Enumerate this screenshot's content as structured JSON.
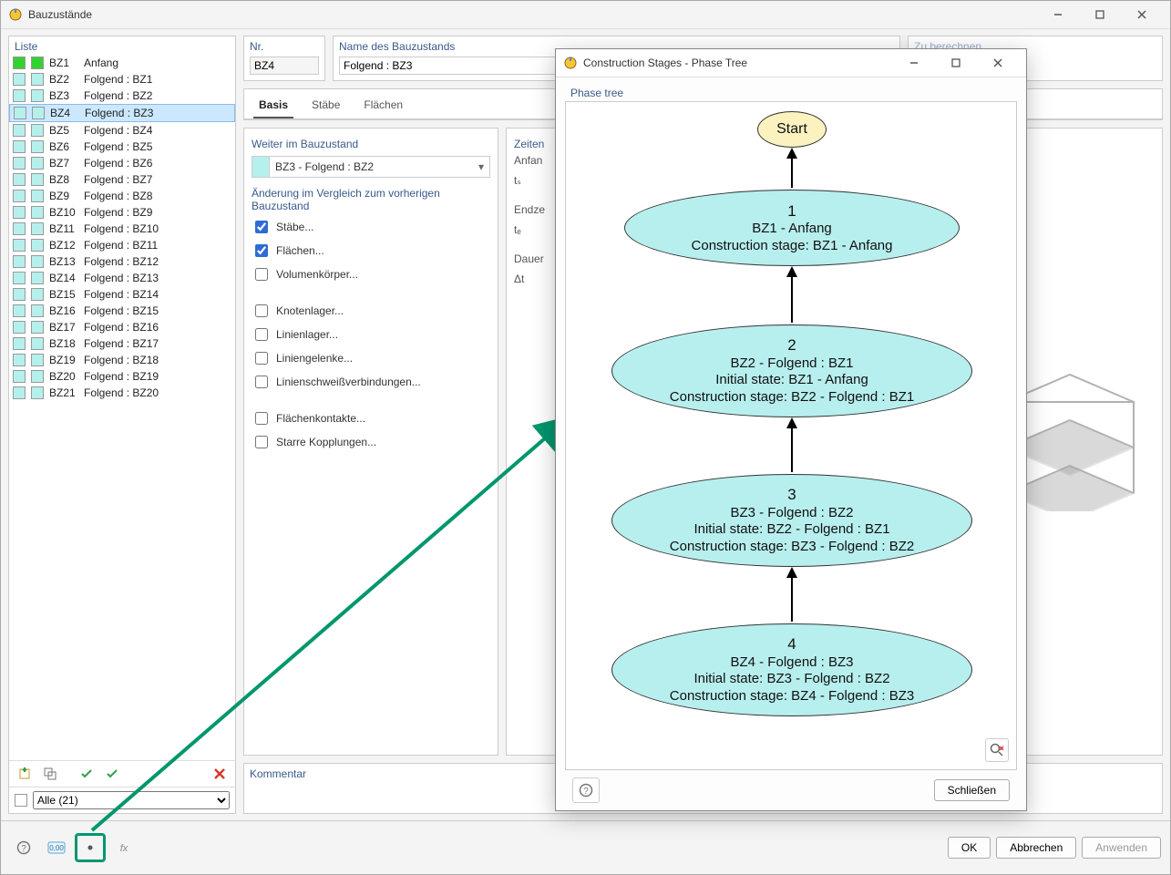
{
  "main_window": {
    "title": "Bauzustände"
  },
  "liste": {
    "title": "Liste",
    "items": [
      {
        "id": "BZ1",
        "label": "Anfang",
        "swatch": "#32d232"
      },
      {
        "id": "BZ2",
        "label": "Folgend : BZ1",
        "swatch": "#b6f0ec"
      },
      {
        "id": "BZ3",
        "label": "Folgend : BZ2",
        "swatch": "#b6f0ec"
      },
      {
        "id": "BZ4",
        "label": "Folgend : BZ3",
        "swatch": "#b6f0ec",
        "selected": true
      },
      {
        "id": "BZ5",
        "label": "Folgend : BZ4",
        "swatch": "#b6f0ec"
      },
      {
        "id": "BZ6",
        "label": "Folgend : BZ5",
        "swatch": "#b6f0ec"
      },
      {
        "id": "BZ7",
        "label": "Folgend : BZ6",
        "swatch": "#b6f0ec"
      },
      {
        "id": "BZ8",
        "label": "Folgend : BZ7",
        "swatch": "#b6f0ec"
      },
      {
        "id": "BZ9",
        "label": "Folgend : BZ8",
        "swatch": "#b6f0ec"
      },
      {
        "id": "BZ10",
        "label": "Folgend : BZ9",
        "swatch": "#b6f0ec"
      },
      {
        "id": "BZ11",
        "label": "Folgend : BZ10",
        "swatch": "#b6f0ec"
      },
      {
        "id": "BZ12",
        "label": "Folgend : BZ11",
        "swatch": "#b6f0ec"
      },
      {
        "id": "BZ13",
        "label": "Folgend : BZ12",
        "swatch": "#b6f0ec"
      },
      {
        "id": "BZ14",
        "label": "Folgend : BZ13",
        "swatch": "#b6f0ec"
      },
      {
        "id": "BZ15",
        "label": "Folgend : BZ14",
        "swatch": "#b6f0ec"
      },
      {
        "id": "BZ16",
        "label": "Folgend : BZ15",
        "swatch": "#b6f0ec"
      },
      {
        "id": "BZ17",
        "label": "Folgend : BZ16",
        "swatch": "#b6f0ec"
      },
      {
        "id": "BZ18",
        "label": "Folgend : BZ17",
        "swatch": "#b6f0ec"
      },
      {
        "id": "BZ19",
        "label": "Folgend : BZ18",
        "swatch": "#b6f0ec"
      },
      {
        "id": "BZ20",
        "label": "Folgend : BZ19",
        "swatch": "#b6f0ec"
      },
      {
        "id": "BZ21",
        "label": "Folgend : BZ20",
        "swatch": "#b6f0ec"
      }
    ],
    "filter_label": "Alle (21)"
  },
  "nr": {
    "title": "Nr.",
    "value": "BZ4"
  },
  "name": {
    "title": "Name des Bauzustands",
    "value": "Folgend : BZ3"
  },
  "berechnen": {
    "title": "Zu berechnen"
  },
  "tabs": {
    "basis": "Basis",
    "staebe": "Stäbe",
    "flaechen": "Flächen"
  },
  "basis": {
    "weiter_title": "Weiter im Bauzustand",
    "weiter_value": "BZ3 - Folgend : BZ2",
    "aenderung_title": "Änderung im Vergleich zum vorherigen Bauzustand",
    "checks": {
      "staebe": "Stäbe...",
      "flaechen": "Flächen...",
      "volumen": "Volumenkörper...",
      "knotenlager": "Knotenlager...",
      "linienlager": "Linienlager...",
      "liniengelenke": "Liniengelenke...",
      "linienschweiss": "Linienschweißverbindungen...",
      "flaechenkontakte": "Flächenkontakte...",
      "starre": "Starre Kopplungen..."
    }
  },
  "zeiten": {
    "title": "Zeiten",
    "anfang": "Anfan",
    "ts": "tₛ",
    "endz": "Endze",
    "te": "tₑ",
    "dauer": "Dauer",
    "dt": "Δt"
  },
  "kommentar": {
    "title": "Kommentar"
  },
  "footer": {
    "ok": "OK",
    "abbrechen": "Abbrechen",
    "anwenden": "Anwenden"
  },
  "dialog": {
    "title": "Construction Stages - Phase Tree",
    "section": "Phase tree",
    "close_btn": "Schließen",
    "start": "Start",
    "nodes": [
      {
        "num": "1",
        "line1": "BZ1 - Anfang",
        "line2": "",
        "line3": "Construction stage: BZ1 - Anfang"
      },
      {
        "num": "2",
        "line1": "BZ2 - Folgend : BZ1",
        "line2": "Initial state: BZ1 - Anfang",
        "line3": "Construction stage: BZ2 - Folgend : BZ1"
      },
      {
        "num": "3",
        "line1": "BZ3 - Folgend : BZ2",
        "line2": "Initial state: BZ2 - Folgend : BZ1",
        "line3": "Construction stage: BZ3 - Folgend : BZ2"
      },
      {
        "num": "4",
        "line1": "BZ4 - Folgend : BZ3",
        "line2": "Initial state: BZ3 - Folgend : BZ2",
        "line3": "Construction stage: BZ4 - Folgend : BZ3"
      }
    ]
  }
}
